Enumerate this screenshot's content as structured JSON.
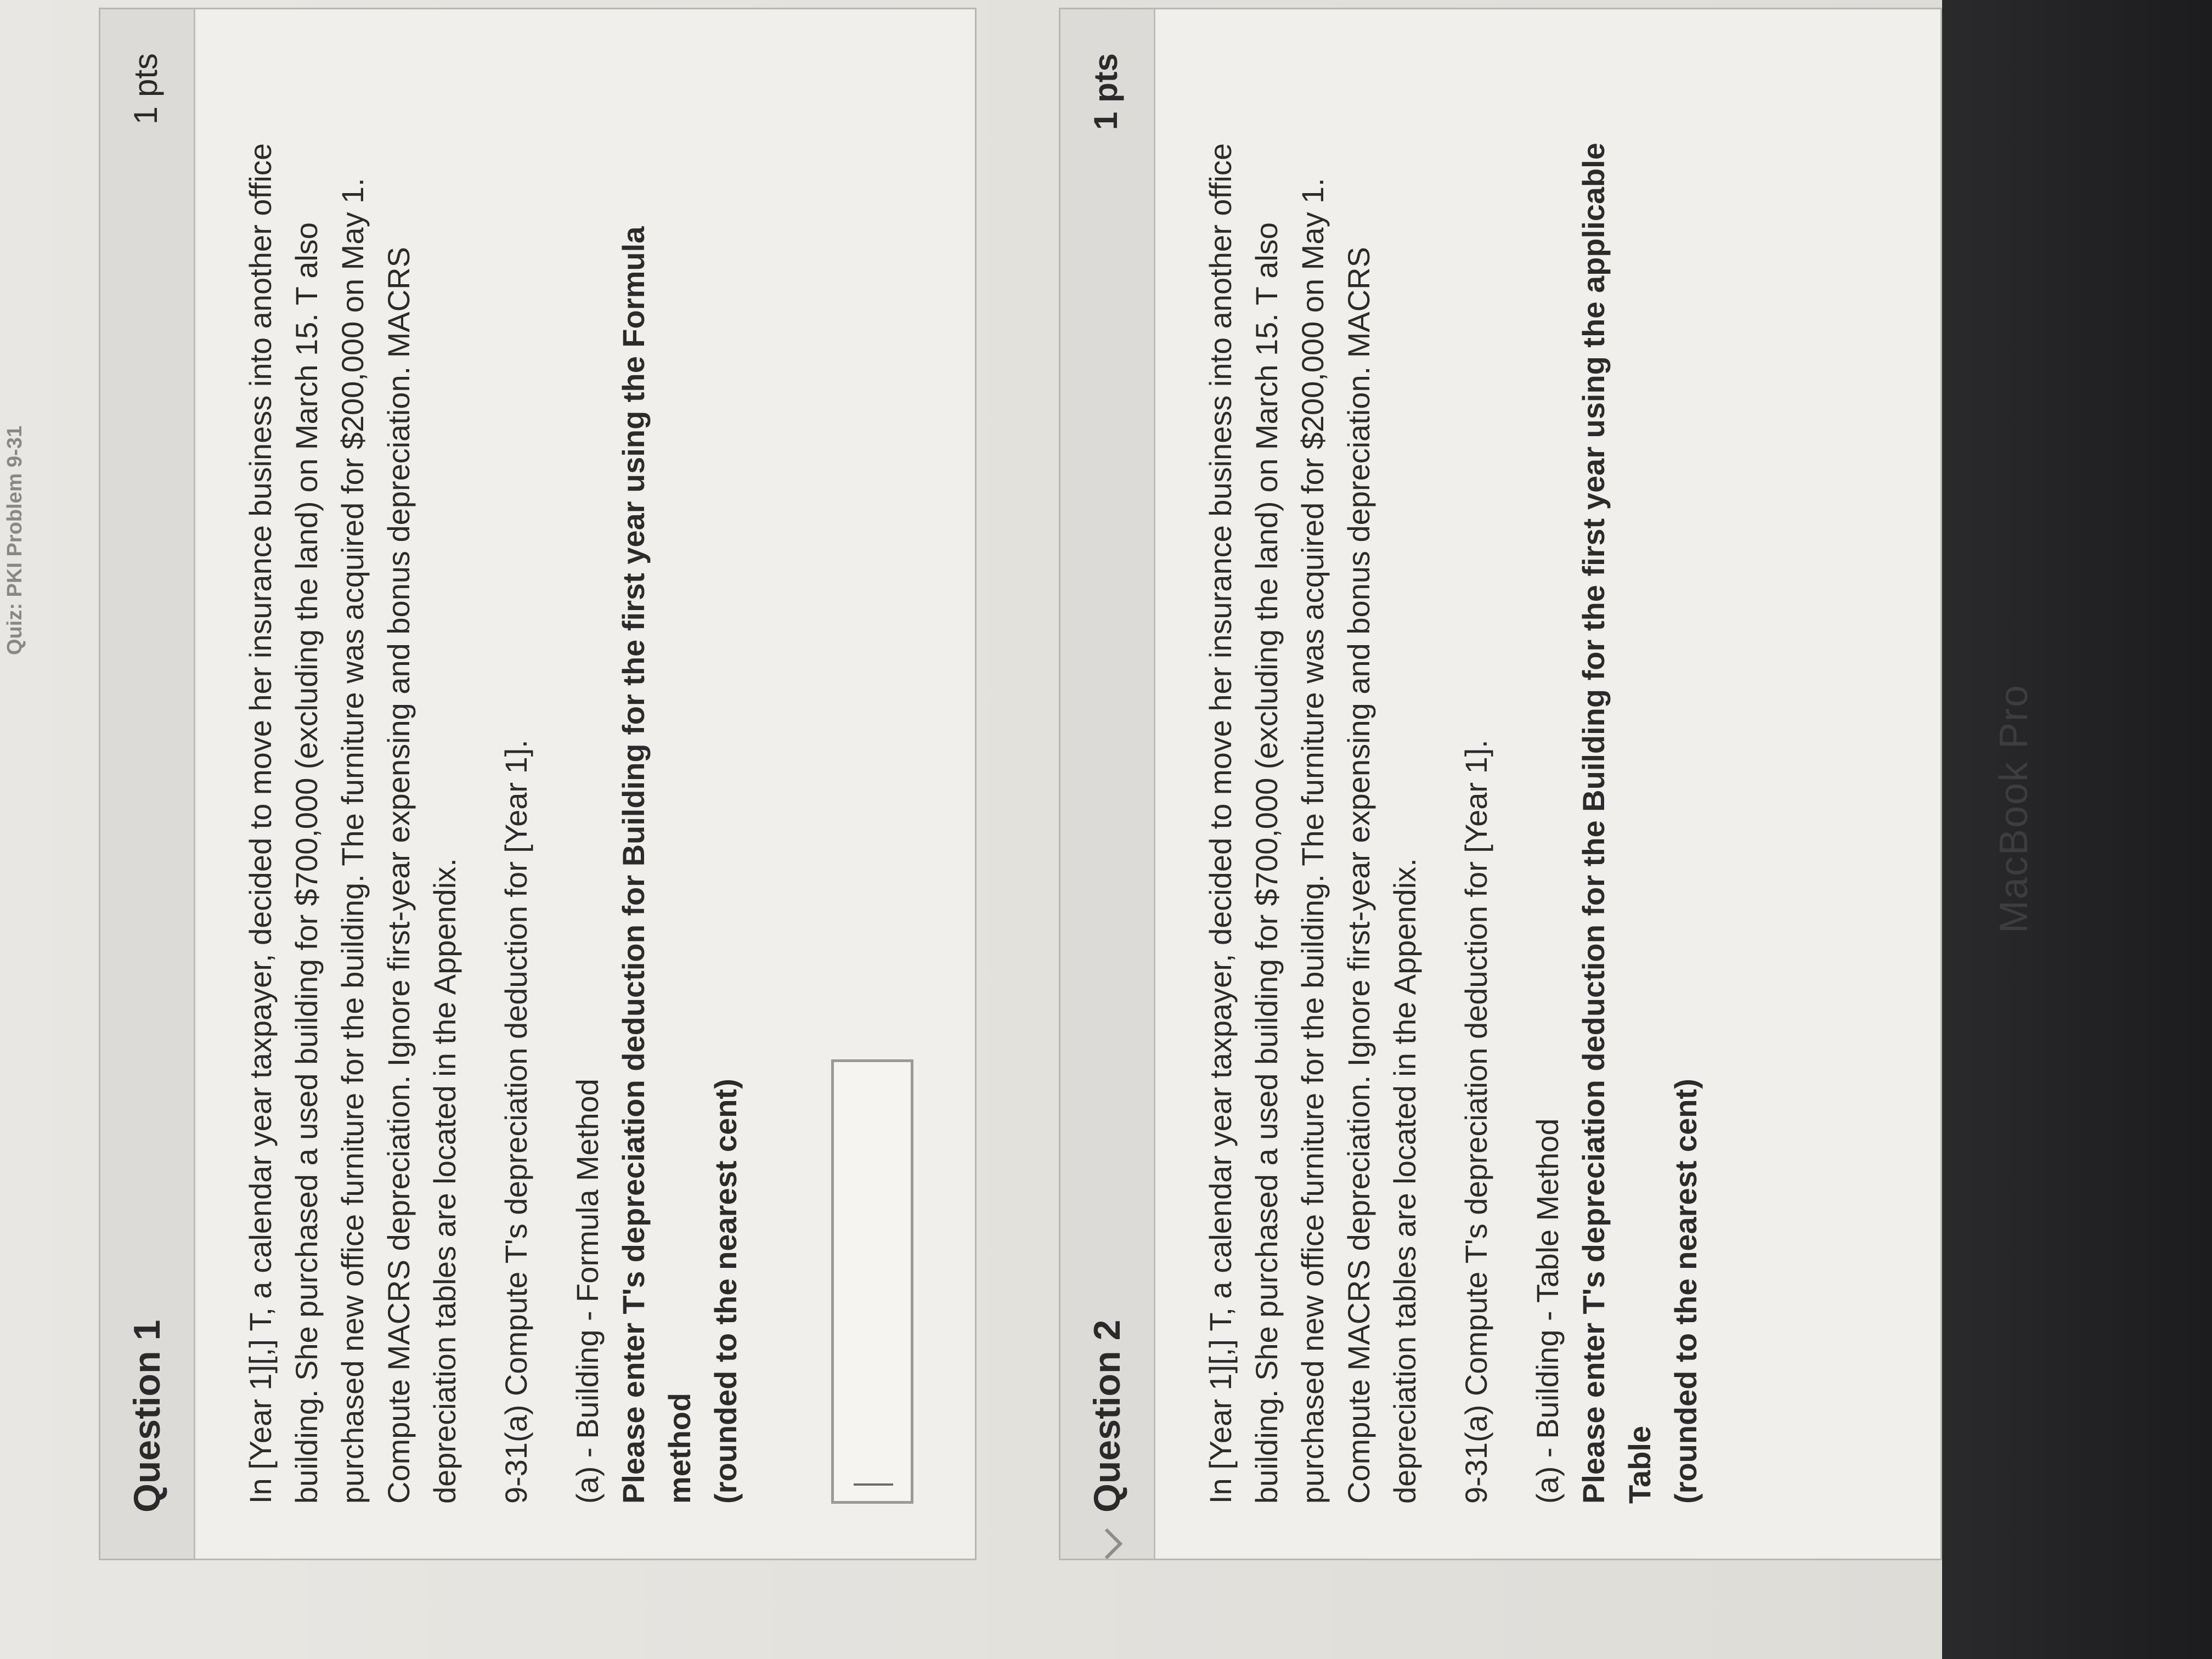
{
  "page": {
    "tab_title": "Quiz: PKI Problem 9-31",
    "device_brand": "MacBook Pro"
  },
  "questions": [
    {
      "title": "Question 1",
      "points": "1 pts",
      "prompt": "In [Year 1][,] T, a calendar year taxpayer, decided to move her insurance business into another office building. She purchased a used building for $700,000 (excluding the land) on March 15. T also purchased new office furniture for the building. The furniture was acquired for $200,000 on May 1. Compute MACRS depreciation. Ignore first-year expensing and bonus depreciation. MACRS depreciation tables are located in the Appendix.",
      "task": "9-31(a) Compute T's depreciation deduction for [Year 1].",
      "part_label": "(a) - Building - Formula Method",
      "instruction": "Please enter T's depreciation deduction for Building for the first year using the Formula method",
      "rounding": "(rounded to the nearest cent)",
      "answer_value": ""
    },
    {
      "title": "Question 2",
      "points": "1 pts",
      "prompt": "In [Year 1][,] T, a calendar year taxpayer, decided to move her insurance business into another office building. She purchased a used building for $700,000 (excluding the land) on March 15. T also purchased new office furniture for the building. The furniture was acquired for $200,000 on May 1. Compute MACRS depreciation. Ignore first-year expensing and bonus depreciation. MACRS depreciation tables are located in the Appendix.",
      "task": "9-31(a) Compute T's depreciation deduction for [Year 1].",
      "part_label": "(a) - Building - Table Method",
      "instruction": "Please enter T's depreciation deduction for the Building for the first year using the applicable Table",
      "rounding": "(rounded to the nearest cent)"
    }
  ],
  "icons": {
    "question_flag": "flag-icon",
    "collapse_arrow": "chevron-icon"
  }
}
